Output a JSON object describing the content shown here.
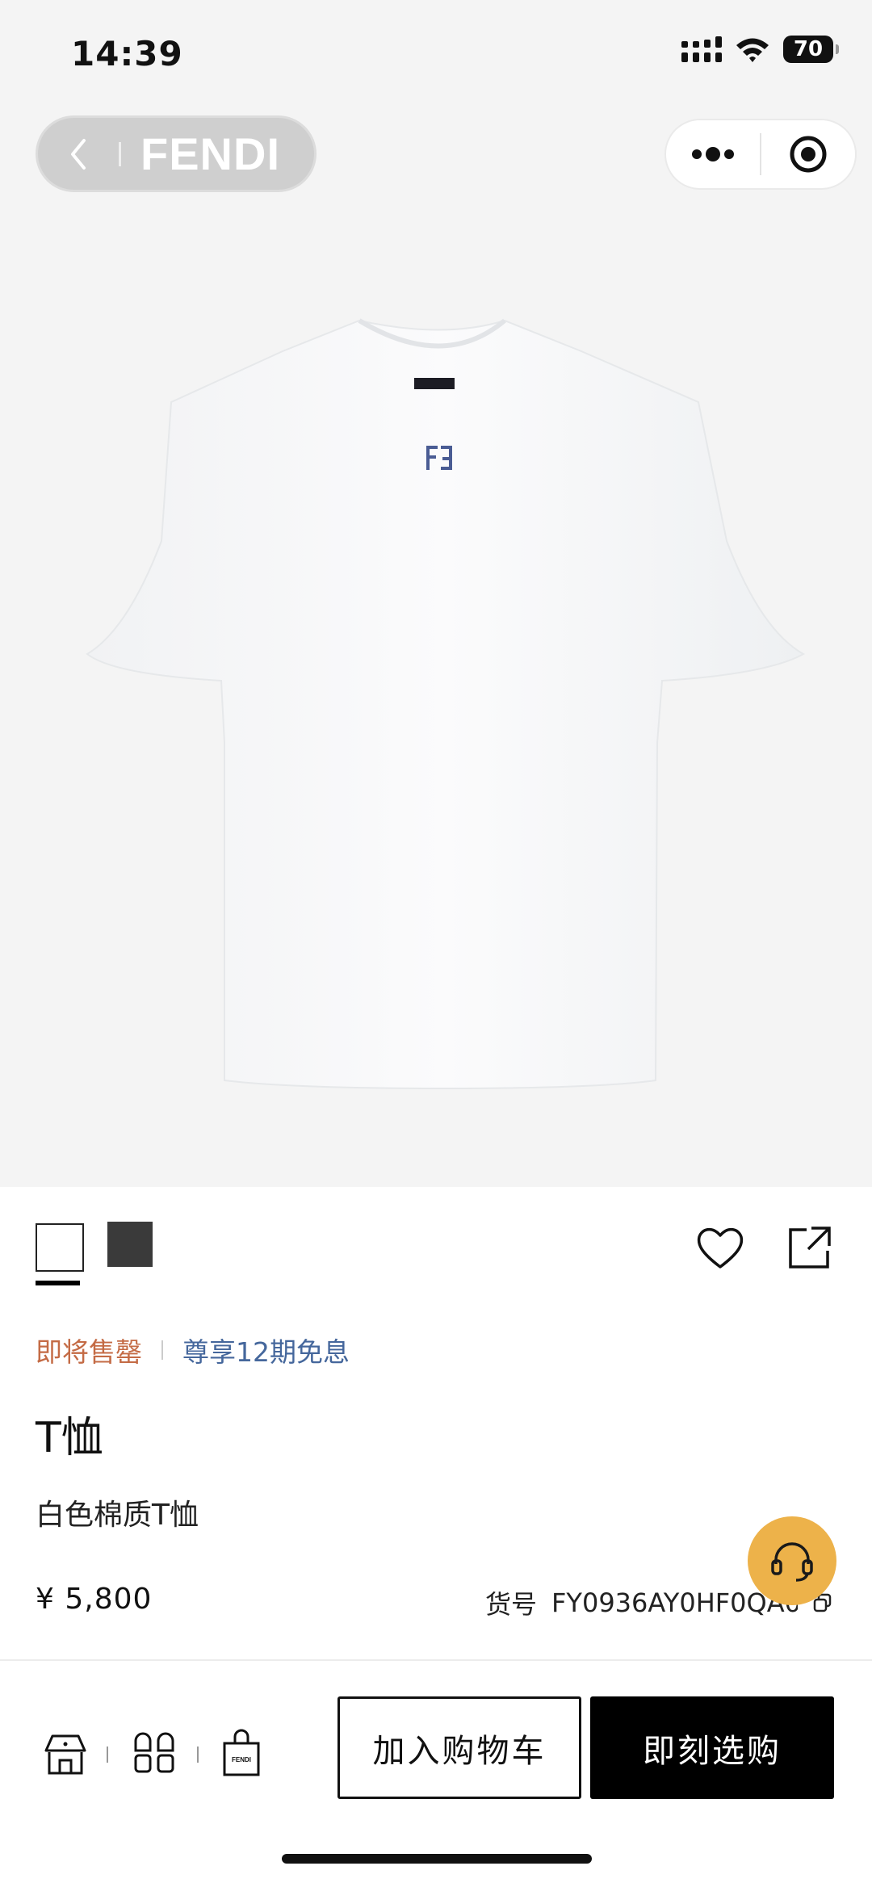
{
  "status_bar": {
    "time": "14:39",
    "battery": "70"
  },
  "nav": {
    "brand": "FENDI"
  },
  "product": {
    "colors": [
      "#ffffff",
      "#3a3a3a"
    ],
    "tag_soldout": "即将售罄",
    "tag_installment": "尊享12期免息",
    "title": "T恤",
    "subtitle": "白色棉质T恤",
    "price": "¥ 5,800",
    "sku_label": "货号",
    "sku_code": "FY0936AY0HF0QA0"
  },
  "bottom_bar": {
    "add_to_cart": "加入购物车",
    "buy_now": "即刻选购",
    "bag_logo": "FENDI"
  },
  "icons": [
    "back-icon",
    "more-icon",
    "target-icon",
    "heart-icon",
    "share-icon",
    "headset-icon",
    "store-icon",
    "categories-icon",
    "shopping-bag-icon"
  ]
}
